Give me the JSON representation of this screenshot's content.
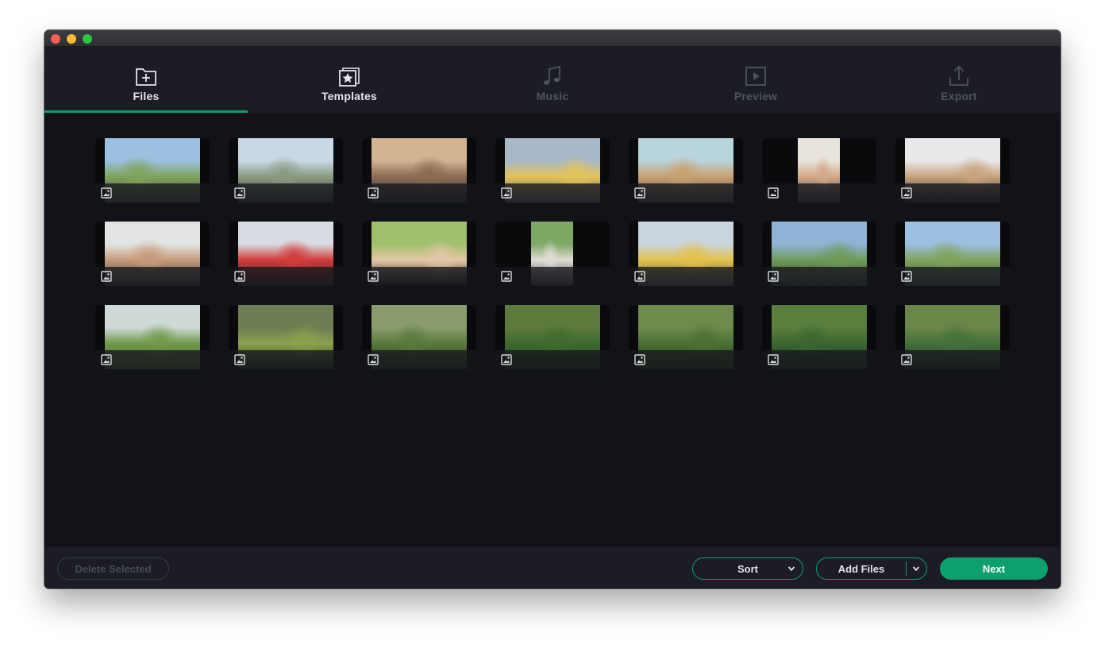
{
  "window": {
    "traffic_lights": [
      "close",
      "minimize",
      "zoom"
    ]
  },
  "tabs": [
    {
      "label": "Files",
      "icon": "folder-plus-icon",
      "state": "active"
    },
    {
      "label": "Templates",
      "icon": "template-star-icon",
      "state": "enabled"
    },
    {
      "label": "Music",
      "icon": "music-note-icon",
      "state": "disabled"
    },
    {
      "label": "Preview",
      "icon": "play-preview-icon",
      "state": "disabled"
    },
    {
      "label": "Export",
      "icon": "export-upload-icon",
      "state": "disabled"
    }
  ],
  "media": [
    {
      "type": "image",
      "orientation": "landscape",
      "palette": [
        "#9cc0e0",
        "#7fa35c",
        "#4b4f45"
      ]
    },
    {
      "type": "image",
      "orientation": "landscape",
      "palette": [
        "#c9d8e6",
        "#8a9a80",
        "#3f3f42"
      ]
    },
    {
      "type": "image",
      "orientation": "landscape",
      "palette": [
        "#d2b392",
        "#8c6a52",
        "#2f3544"
      ]
    },
    {
      "type": "image",
      "orientation": "landscape",
      "palette": [
        "#a8b8c8",
        "#e2c25a",
        "#5a6070"
      ]
    },
    {
      "type": "image",
      "orientation": "landscape",
      "palette": [
        "#b8d4dc",
        "#c8a070",
        "#4a4a50"
      ]
    },
    {
      "type": "image",
      "orientation": "portrait",
      "palette": [
        "#e8e4dc",
        "#d3a888",
        "#3a3b40"
      ]
    },
    {
      "type": "image",
      "orientation": "landscape",
      "palette": [
        "#e6e8ea",
        "#c8a27c",
        "#2e3038"
      ]
    },
    {
      "type": "image",
      "orientation": "landscape",
      "palette": [
        "#e2e4e2",
        "#c59b7a",
        "#3a3a3e"
      ]
    },
    {
      "type": "image",
      "orientation": "landscape",
      "palette": [
        "#d8dce2",
        "#d23b3b",
        "#2a2a30"
      ]
    },
    {
      "type": "image",
      "orientation": "landscape",
      "palette": [
        "#9fbf6a",
        "#e3c6a8",
        "#1e1e22"
      ]
    },
    {
      "type": "image",
      "orientation": "portrait",
      "palette": [
        "#7fa867",
        "#e0dcd4",
        "#3a3e44"
      ]
    },
    {
      "type": "image",
      "orientation": "landscape",
      "palette": [
        "#c9d4dc",
        "#e3c14a",
        "#4c5258"
      ]
    },
    {
      "type": "image",
      "orientation": "landscape",
      "palette": [
        "#8fb2d6",
        "#6e9a58",
        "#3e4042"
      ]
    },
    {
      "type": "image",
      "orientation": "landscape",
      "palette": [
        "#9cc0e0",
        "#7fa35c",
        "#474a4c"
      ]
    },
    {
      "type": "image",
      "orientation": "landscape",
      "palette": [
        "#cfd9d8",
        "#6f9a4a",
        "#4c5a3a"
      ]
    },
    {
      "type": "image",
      "orientation": "landscape",
      "palette": [
        "#6e7d52",
        "#8aa04c",
        "#2c3424"
      ]
    },
    {
      "type": "image",
      "orientation": "landscape",
      "palette": [
        "#8a9c6e",
        "#5a7a3c",
        "#2e3628"
      ]
    },
    {
      "type": "image",
      "orientation": "landscape",
      "palette": [
        "#5c7a3c",
        "#3f6a2e",
        "#2a3a22"
      ]
    },
    {
      "type": "image",
      "orientation": "landscape",
      "palette": [
        "#6e8a4c",
        "#4a7034",
        "#2c3826"
      ]
    },
    {
      "type": "image",
      "orientation": "landscape",
      "palette": [
        "#5a7e3e",
        "#3c6630",
        "#263424"
      ]
    },
    {
      "type": "image",
      "orientation": "landscape",
      "palette": [
        "#6a8648",
        "#43703a",
        "#2a3a28"
      ]
    }
  ],
  "footer": {
    "delete_label": "Delete Selected",
    "sort_label": "Sort",
    "add_files_label": "Add Files",
    "next_label": "Next"
  },
  "colors": {
    "accent": "#0e9f6e",
    "background": "#121318",
    "panel": "#1c1d24"
  }
}
